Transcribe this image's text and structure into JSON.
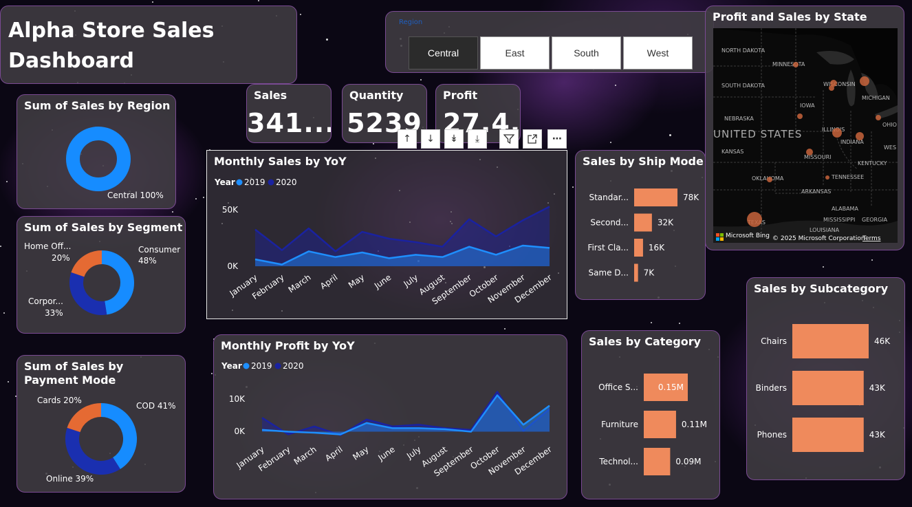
{
  "title": "Alpha Store Sales Dashboard",
  "slicer": {
    "label": "Region",
    "options": [
      "Central",
      "East",
      "South",
      "West"
    ],
    "selected": "Central"
  },
  "kpis": {
    "sales": {
      "label": "Sales",
      "value": "341...."
    },
    "quantity": {
      "label": "Quantity",
      "value": "5239"
    },
    "profit": {
      "label": "Profit",
      "value": "27.4..."
    }
  },
  "region_donut": {
    "title": "Sum of Sales by Region",
    "label": "Central 100%",
    "color": "#168cff"
  },
  "segment_donut": {
    "title": "Sum of Sales by Segment",
    "slices": [
      {
        "name": "Consumer",
        "pct": "48%",
        "value": 48,
        "color": "#168cff"
      },
      {
        "name": "Corpor...",
        "pct": "33%",
        "value": 33,
        "color": "#1a2fb0"
      },
      {
        "name": "Home Off...",
        "pct": "20%",
        "value": 20,
        "color": "#e56a33"
      }
    ]
  },
  "payment_donut": {
    "title": "Sum of Sales by Payment Mode",
    "slices": [
      {
        "name": "COD",
        "label": "COD 41%",
        "value": 41,
        "color": "#168cff"
      },
      {
        "name": "Online",
        "label": "Online 39%",
        "value": 39,
        "color": "#1a2fb0"
      },
      {
        "name": "Cards",
        "label": "Cards 20%",
        "value": 20,
        "color": "#e56a33"
      }
    ]
  },
  "toolbar": [
    "up-arrow",
    "down-arrow",
    "double-down-arrow",
    "expand-down",
    "filter",
    "focus-mode",
    "more-options"
  ],
  "monthly_sales": {
    "title": "Monthly Sales by YoY",
    "legend_title": "Year",
    "series_names": [
      "2019",
      "2020"
    ],
    "colors": [
      "#1e8fff",
      "#1a22a0"
    ],
    "months": [
      "January",
      "February",
      "March",
      "April",
      "May",
      "June",
      "July",
      "August",
      "September",
      "October",
      "November",
      "December"
    ],
    "y_ticks": [
      "50K",
      "0K"
    ],
    "ylim": [
      0,
      60000
    ],
    "values_2019": [
      6000,
      1500,
      13000,
      8000,
      12000,
      7000,
      10000,
      8000,
      17000,
      10000,
      18000,
      16000
    ],
    "values_2020": [
      32000,
      14000,
      33000,
      13000,
      30000,
      24000,
      21000,
      17000,
      41000,
      26000,
      40000,
      52000
    ]
  },
  "monthly_profit": {
    "title": "Monthly Profit by YoY",
    "legend_title": "Year",
    "series_names": [
      "2019",
      "2020"
    ],
    "colors": [
      "#1e8fff",
      "#1a22a0"
    ],
    "months": [
      "January",
      "February",
      "March",
      "April",
      "May",
      "June",
      "July",
      "August",
      "September",
      "October",
      "November",
      "December"
    ],
    "y_ticks": [
      "10K",
      "0K"
    ],
    "ylim": [
      -1500,
      13000
    ],
    "values_2019": [
      500,
      0,
      -300,
      -800,
      2500,
      1000,
      1000,
      700,
      0,
      10500,
      2000,
      7500
    ],
    "values_2020": [
      4000,
      -800,
      1500,
      -1000,
      3500,
      1500,
      2000,
      1000,
      500,
      11500,
      200,
      6500
    ]
  },
  "ship_mode": {
    "title": "Sales by Ship Mode",
    "categories": [
      "Standar...",
      "Second...",
      "First Cla...",
      "Same D..."
    ],
    "labels": [
      "78K",
      "32K",
      "16K",
      "7K"
    ],
    "values": [
      78000,
      32000,
      16000,
      7000
    ],
    "color": "#ef8a5c"
  },
  "category": {
    "title": "Sales by Category",
    "categories": [
      "Office S...",
      "Furniture",
      "Technol..."
    ],
    "labels": [
      "0.15M",
      "0.11M",
      "0.09M"
    ],
    "values": [
      0.15,
      0.11,
      0.09
    ],
    "color": "#ef8a5c"
  },
  "subcategory": {
    "title": "Sales by Subcategory",
    "categories": [
      "Chairs",
      "Binders",
      "Phones"
    ],
    "labels": [
      "46K",
      "43K",
      "43K"
    ],
    "values": [
      46000,
      43000,
      43000
    ],
    "color": "#ef8a5c"
  },
  "map": {
    "title": "Profit and Sales by State",
    "country_label": "UNITED STATES",
    "state_labels": [
      "NORTH DAKOTA",
      "MINNESOTA",
      "SOUTH DAKOTA",
      "WISCONSIN",
      "MICHIGAN",
      "IOWA",
      "NEBRASKA",
      "ILLINOIS",
      "INDIANA",
      "OHIO",
      "KANSAS",
      "MISSOURI",
      "KENTUCKY",
      "WES",
      "TENNESSEE",
      "OKLAHOMA",
      "ARKANSAS",
      "ALABAMA",
      "MISSISSIPPI",
      "GEORGIA",
      "TEXAS",
      "LOUISIANA"
    ],
    "brand": "Microsoft Bing",
    "copyright": "© 2025 Microsoft Corporation",
    "terms": "Terms",
    "bubble_color": "#c8643c"
  }
}
